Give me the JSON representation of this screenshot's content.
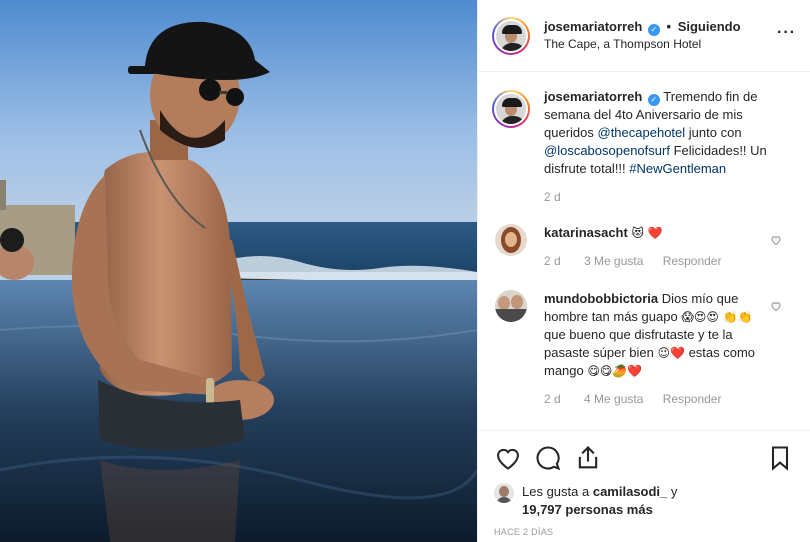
{
  "header": {
    "username": "josemariatorreh",
    "separator": "•",
    "follow_status": "Siguiendo",
    "location": "The Cape, a Thompson Hotel",
    "more_label": "···",
    "verified_glyph": "✓"
  },
  "caption": {
    "username": "josemariatorreh",
    "text_1": "Tremendo fin de semana del 4to Aniversario de mis queridos",
    "mention_1": "@thecapehotel",
    "text_2": "junto con",
    "mention_2": "@loscabosopenofsurf",
    "text_3": "Felicidades!! Un disfrute total!!!",
    "hashtag": "#NewGentleman",
    "time": "2 d"
  },
  "comments": [
    {
      "username": "katarinasacht",
      "text": "",
      "emoji": "😻 ❤️",
      "time": "2 d",
      "likes": "3 Me gusta",
      "reply": "Responder"
    },
    {
      "username": "mundobobbictoria",
      "text": "Dios mío que hombre tan más guapo",
      "emoji_1": "😱😍😍 👏👏",
      "text_2": "que bueno que disfrutaste y te la pasaste súper bien",
      "emoji_2": "😉❤️",
      "text_3": "estas como mango",
      "emoji_3": "😋😋🥭❤️",
      "time": "2 d",
      "likes": "4 Me gusta",
      "reply": "Responder"
    }
  ],
  "likes": {
    "prefix": "Les gusta a",
    "user": "camilasodi_",
    "conj": "y",
    "count": "19,797 personas más"
  },
  "posted": "HACE 2 DÍAS",
  "icons": {
    "like": "heart-icon",
    "comment": "comment-icon",
    "share": "share-icon",
    "save": "bookmark-icon"
  }
}
